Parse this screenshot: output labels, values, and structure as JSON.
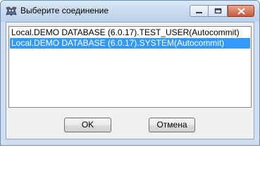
{
  "window": {
    "title": "Выберите соединение",
    "controls": {
      "minimize_icon": "minimize-icon",
      "maximize_icon": "maximize-icon",
      "close_icon": "close-icon"
    }
  },
  "connections": {
    "items": [
      {
        "label": "Local.DEMO DATABASE (6.0.17).TEST_USER(Autocommit)",
        "selected": false
      },
      {
        "label": "Local.DEMO DATABASE (6.0.17).SYSTEM(Autocommit)",
        "selected": true
      }
    ],
    "selection_color": "#3399ff"
  },
  "buttons": {
    "ok_label": "OK",
    "cancel_label": "Отмена"
  }
}
